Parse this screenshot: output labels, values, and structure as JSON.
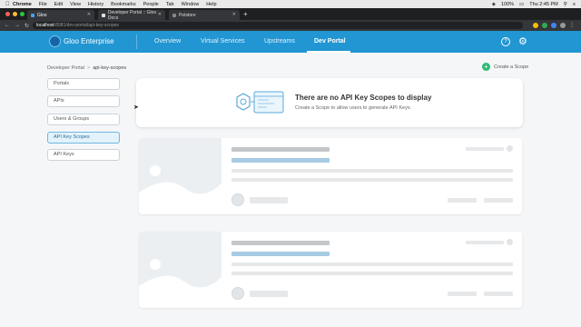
{
  "os_menubar": {
    "app": "Chrome",
    "items": [
      "File",
      "Edit",
      "View",
      "History",
      "Bookmarks",
      "People",
      "Tab",
      "Window",
      "Help"
    ],
    "battery": "100%",
    "clock": "Thu 2:45 PM"
  },
  "browser": {
    "tabs": [
      {
        "label": "Gloo"
      },
      {
        "label": "Developer Portal :: Gloo Docs"
      },
      {
        "label": "Petstore"
      }
    ],
    "url_host": "localhost",
    "url_path": ":8081/dev-portal/api-key-scopes"
  },
  "app": {
    "brand": "Gloo Enterprise",
    "nav": [
      "Overview",
      "Virtual Services",
      "Upstreams",
      "Dev Portal"
    ],
    "active_nav": "Dev Portal",
    "help_label": "?",
    "accent_color": "#2196d3"
  },
  "breadcrumb": {
    "root": "Developer Portal",
    "separator": ">",
    "current": "api-key-scopes"
  },
  "create_button": {
    "label": "Create a Scope",
    "color": "#2eb872"
  },
  "sidebar": {
    "items": [
      {
        "label": "Portals"
      },
      {
        "label": "APIs"
      },
      {
        "label": "Users & Groups"
      },
      {
        "label": "API Key Scopes"
      },
      {
        "label": "API Keys"
      }
    ],
    "active": "API Key Scopes"
  },
  "empty_state": {
    "title": "There are no API Key Scopes to display",
    "subtitle": "Create a Scope to allow users to generate API Keys."
  }
}
